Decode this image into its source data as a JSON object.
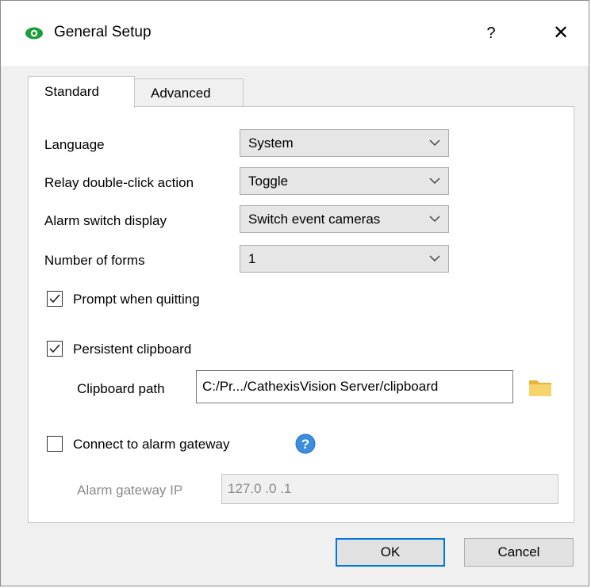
{
  "window": {
    "title": "General Setup",
    "help_label": "?",
    "close_label": "✕",
    "icon": "eye-icon"
  },
  "tabs": [
    {
      "label": "Standard",
      "active": true
    },
    {
      "label": "Advanced",
      "active": false
    }
  ],
  "fields": {
    "language": {
      "label": "Language",
      "value": "System"
    },
    "relay": {
      "label": "Relay double-click action",
      "value": "Toggle"
    },
    "alarm_switch": {
      "label": "Alarm switch display",
      "value": "Switch event cameras"
    },
    "forms": {
      "label": "Number of forms",
      "value": "1"
    }
  },
  "prompt_quit": {
    "label": "Prompt when quitting",
    "checked": true
  },
  "persistent_clipboard": {
    "label": "Persistent clipboard",
    "checked": true
  },
  "clipboard_path": {
    "label": "Clipboard path",
    "value": "C:/Pr.../CathexisVision Server/clipboard",
    "icon": "folder-icon"
  },
  "alarm_gateway": {
    "label": "Connect to alarm gateway",
    "checked": false,
    "help_icon": "help-icon"
  },
  "gateway_ip": {
    "label": "Alarm gateway IP",
    "value": "127.0 .0 .1"
  },
  "buttons": {
    "ok": "OK",
    "cancel": "Cancel"
  },
  "colors": {
    "accent": "#0078d7",
    "icon_green": "#1a9e3a",
    "help_blue": "#3b8de0",
    "folder": "#f2c94c"
  }
}
